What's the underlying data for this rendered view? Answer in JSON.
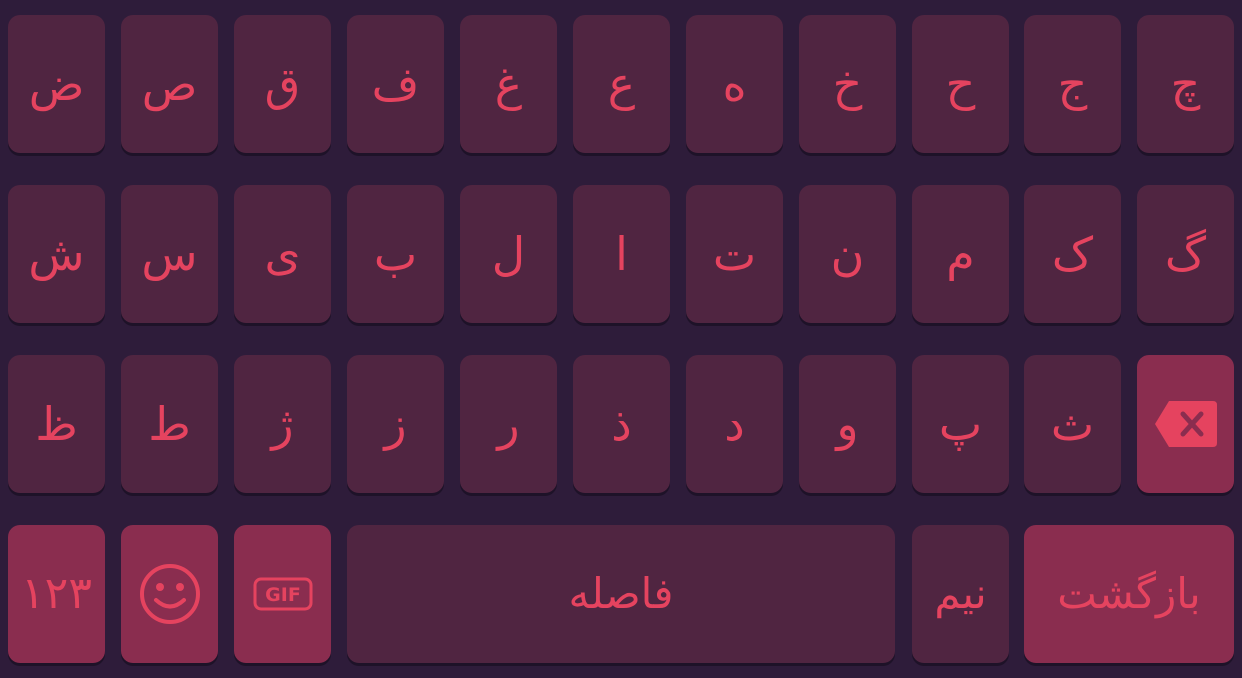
{
  "keyboard": {
    "rows": [
      [
        "ض",
        "ص",
        "ق",
        "ف",
        "غ",
        "ع",
        "ه",
        "خ",
        "ح",
        "ج",
        "چ"
      ],
      [
        "ش",
        "س",
        "ی",
        "ب",
        "ل",
        "ا",
        "ت",
        "ن",
        "م",
        "ک",
        "گ"
      ],
      [
        "ظ",
        "ط",
        "ژ",
        "ز",
        "ر",
        "ذ",
        "د",
        "و",
        "پ",
        "ث"
      ]
    ],
    "bottom": {
      "numbers_label": "۱۲۳",
      "space_label": "فاصله",
      "half_space_label": "نیم",
      "return_label": "بازگشت",
      "gif_label": "GIF"
    }
  },
  "icons": {
    "backspace": "backspace-icon",
    "emoji": "emoji-icon",
    "gif": "gif-icon"
  },
  "colors": {
    "background": "#2e1c3a",
    "key": "#502541",
    "key_accent": "#8a2d4f",
    "glyph": "#e5435f"
  }
}
